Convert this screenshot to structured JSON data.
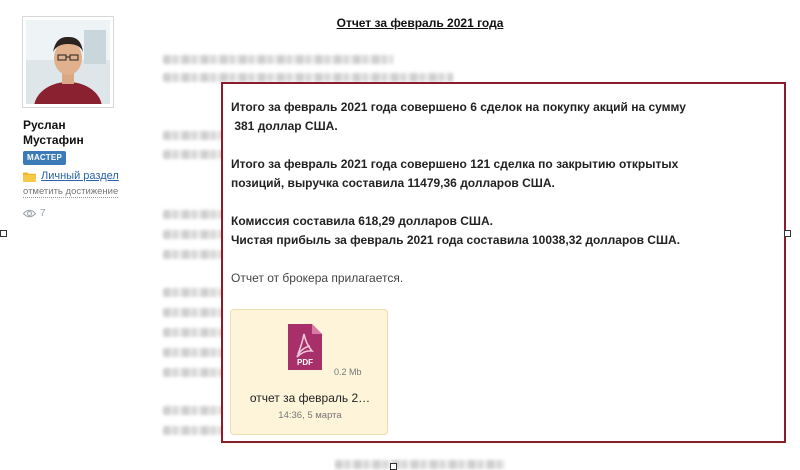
{
  "user": {
    "first_name": "Руслан",
    "last_name": "Мустафин",
    "badge": "МАСТЕР",
    "personal_link": "Личный раздел",
    "achievement_link": "отметить достижение",
    "views": "7"
  },
  "report": {
    "title": "Отчет за февраль 2021 года"
  },
  "summary": {
    "line1": "Итого за февраль 2021 года совершено 6 сделок на покупку акций на сумму",
    "line2": " 381 доллар США.",
    "line3": "Итого за февраль 2021 года совершено 121 сделка по закрытию открытых",
    "line4": "позиций, выручка составила 11479,36 долларов США.",
    "line5": "Комиссия составила 618,29 долларов США.",
    "line6": "Чистая прибыль за февраль 2021 года составила 10038,32 долларов США.",
    "note": "Отчет от брокера прилагается."
  },
  "attachment": {
    "type_label": "PDF",
    "size": "0.2 Mb",
    "name": "отчет за февраль 2…",
    "date": "14:36, 5 марта"
  },
  "colors": {
    "box_border": "#8b1c2c",
    "badge": "#3b7cb8",
    "link": "#2a62a8",
    "pdf_icon": "#a8306a",
    "card_bg": "#fdf4da"
  }
}
